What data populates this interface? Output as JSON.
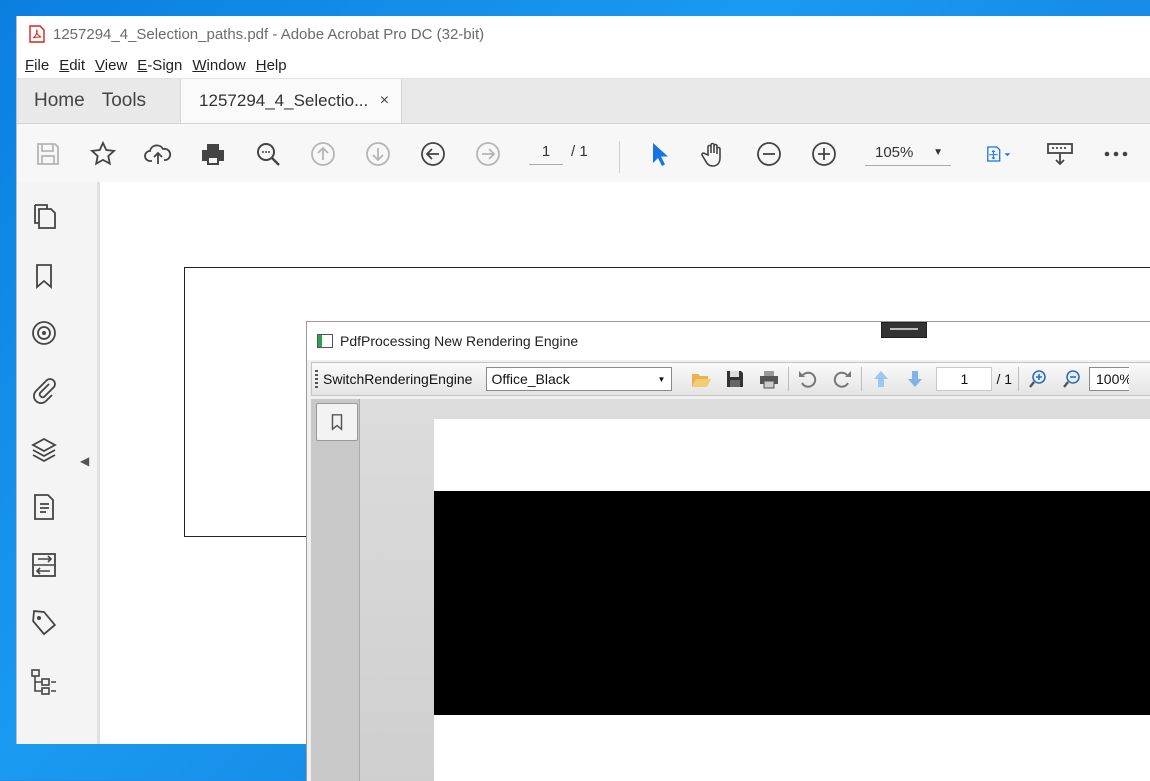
{
  "acrobat": {
    "title": "1257294_4_Selection_paths.pdf - Adobe Acrobat Pro DC (32-bit)",
    "menu": [
      "File",
      "Edit",
      "View",
      "E-Sign",
      "Window",
      "Help"
    ],
    "tabs": {
      "home": "Home",
      "tools": "Tools",
      "document": "1257294_4_Selectio...",
      "close": "×"
    },
    "toolbar": {
      "page_current": "1",
      "page_total": "/ 1",
      "zoom": "105%"
    },
    "colors": {
      "accent": "#1473e6"
    }
  },
  "telerik": {
    "title": "PdfProcessing New Rendering Engine",
    "toolbar": {
      "engine_label": "SwitchRenderingEngine",
      "theme_selected": "Office_Black",
      "page_current": "1",
      "page_total": "/ 1",
      "zoom": "100%"
    }
  }
}
